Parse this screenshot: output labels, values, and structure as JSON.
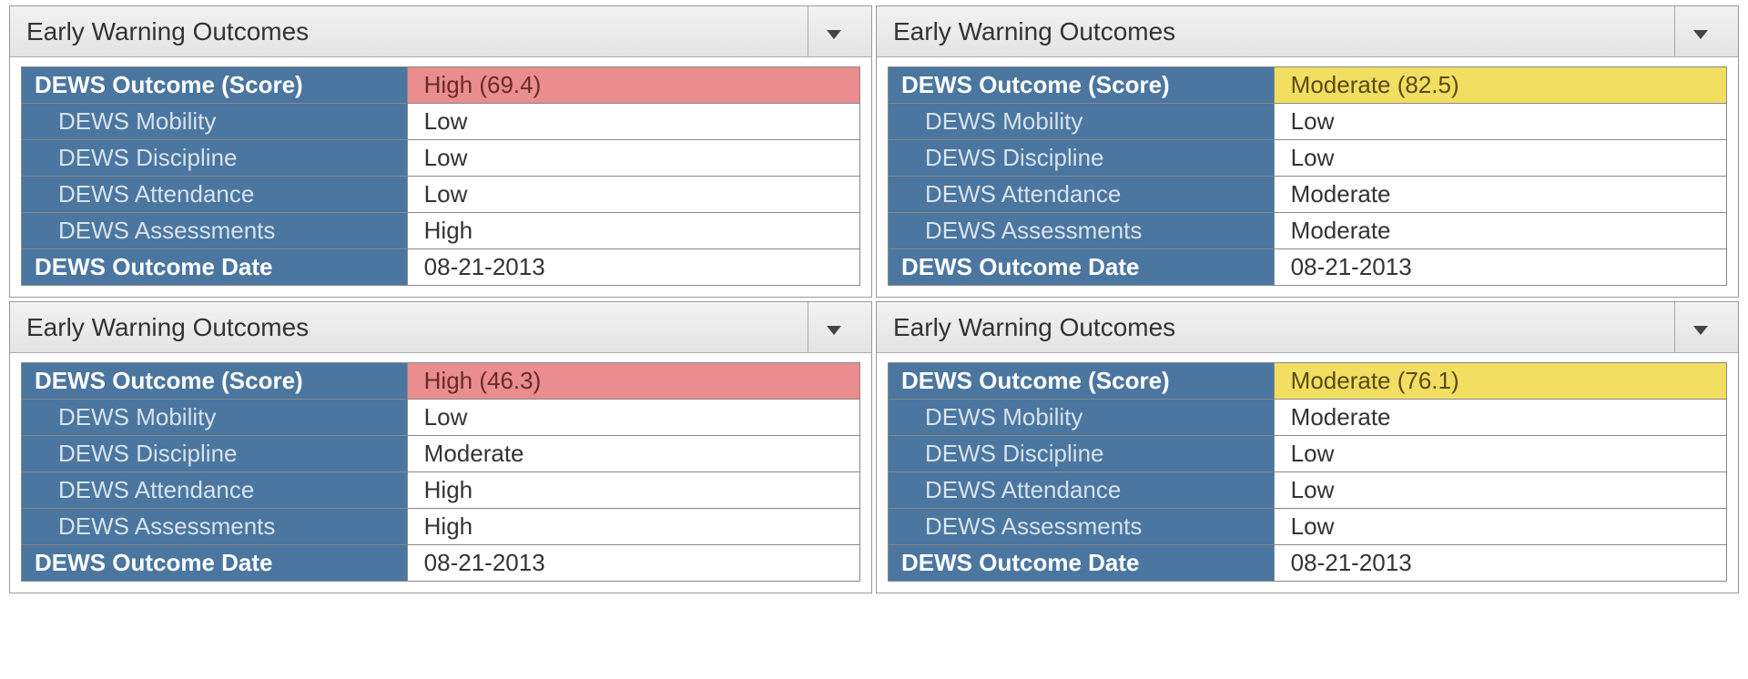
{
  "labels": {
    "panel_title": "Early Warning Outcomes",
    "outcome_score": "DEWS Outcome (Score)",
    "mobility": "DEWS Mobility",
    "discipline": "DEWS Discipline",
    "attendance": "DEWS Attendance",
    "assessments": "DEWS Assessments",
    "outcome_date": "DEWS Outcome Date"
  },
  "panels": [
    {
      "score_text": "High (69.4)",
      "score_level": "high",
      "mobility": "Low",
      "discipline": "Low",
      "attendance": "Low",
      "assessments": "High",
      "date": "08-21-2013"
    },
    {
      "score_text": "Moderate (82.5)",
      "score_level": "moderate",
      "mobility": "Low",
      "discipline": "Low",
      "attendance": "Moderate",
      "assessments": "Moderate",
      "date": "08-21-2013"
    },
    {
      "score_text": "High (46.3)",
      "score_level": "high",
      "mobility": "Low",
      "discipline": "Moderate",
      "attendance": "High",
      "assessments": "High",
      "date": "08-21-2013"
    },
    {
      "score_text": "Moderate (76.1)",
      "score_level": "moderate",
      "mobility": "Moderate",
      "discipline": "Low",
      "attendance": "Low",
      "assessments": "Low",
      "date": "08-21-2013"
    }
  ]
}
